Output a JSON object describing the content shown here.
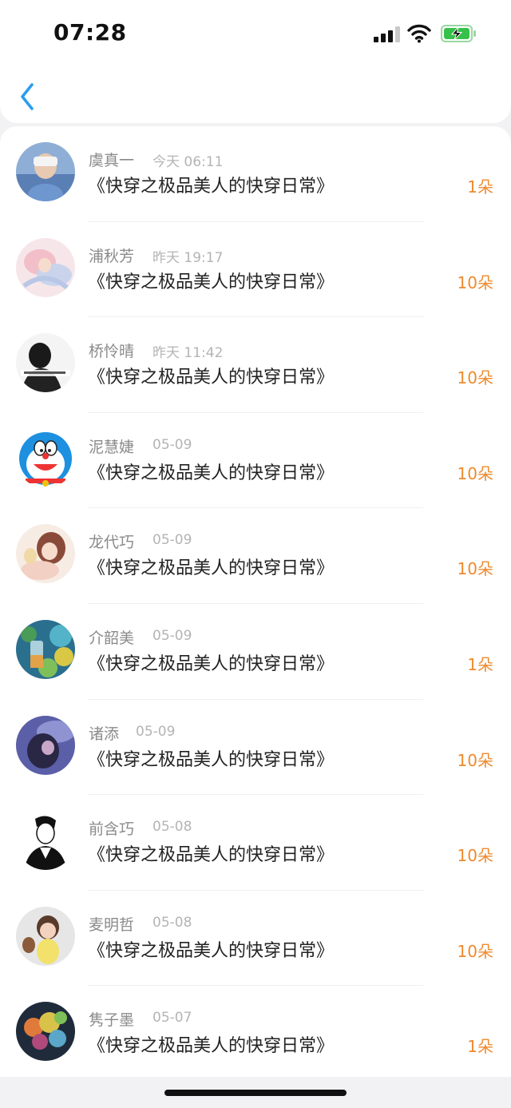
{
  "status_bar": {
    "time": "07:28"
  },
  "nav": {
    "back_icon": "chevron-left-icon"
  },
  "records": [
    {
      "name": "虞真一",
      "time": "今天 06:11",
      "title": "《快穿之极品美人的快穿日常》",
      "amount": "1朵"
    },
    {
      "name": "浦秋芳",
      "time": "昨天 19:17",
      "title": "《快穿之极品美人的快穿日常》",
      "amount": "10朵"
    },
    {
      "name": "桥怜晴",
      "time": "昨天 11:42",
      "title": "《快穿之极品美人的快穿日常》",
      "amount": "10朵"
    },
    {
      "name": "泥慧婕",
      "time": "05-09",
      "title": "《快穿之极品美人的快穿日常》",
      "amount": "10朵"
    },
    {
      "name": "龙代巧",
      "time": "05-09",
      "title": "《快穿之极品美人的快穿日常》",
      "amount": "10朵"
    },
    {
      "name": "介韶美",
      "time": "05-09",
      "title": "《快穿之极品美人的快穿日常》",
      "amount": "1朵"
    },
    {
      "name": "诸添",
      "time": "05-09",
      "title": "《快穿之极品美人的快穿日常》",
      "amount": "10朵"
    },
    {
      "name": "前含巧",
      "time": "05-08",
      "title": "《快穿之极品美人的快穿日常》",
      "amount": "10朵"
    },
    {
      "name": "麦明哲",
      "time": "05-08",
      "title": "《快穿之极品美人的快穿日常》",
      "amount": "10朵"
    },
    {
      "name": "隽子墨",
      "time": "05-07",
      "title": "《快穿之极品美人的快穿日常》",
      "amount": "1朵"
    }
  ],
  "colors": {
    "accent_blue": "#2a9ef0",
    "amount_orange": "#ee8a2e",
    "battery_green": "#36c24a"
  }
}
